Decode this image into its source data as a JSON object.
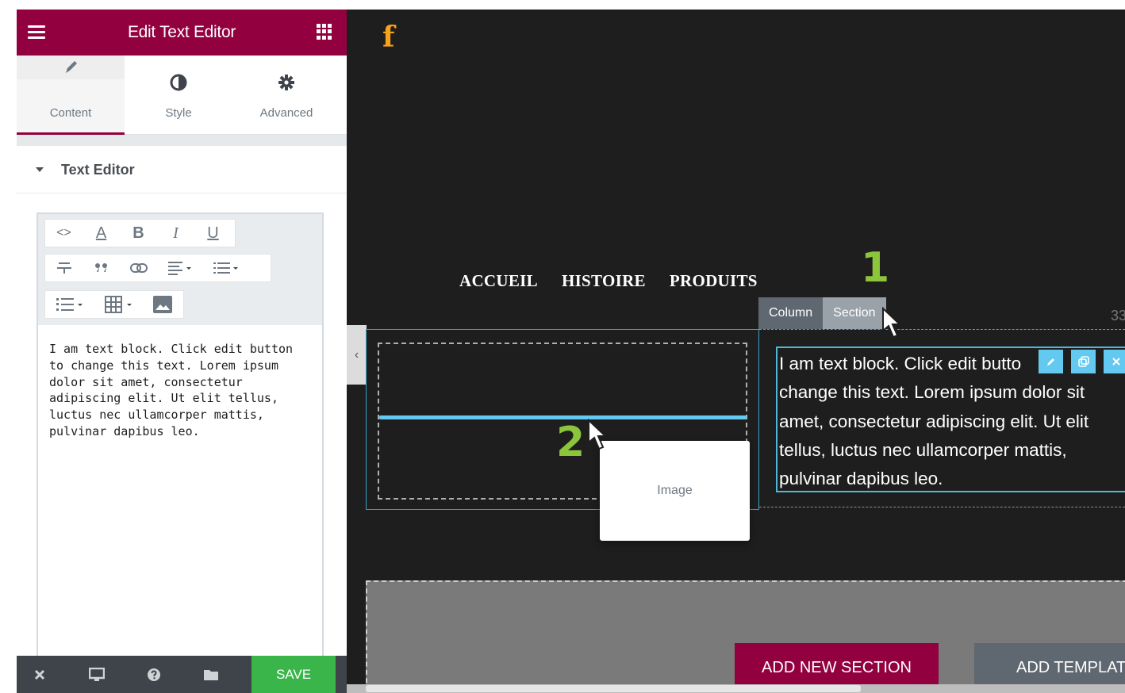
{
  "panel": {
    "title": "Edit Text Editor",
    "tabs": [
      {
        "label": "Content",
        "icon": "pencil-icon",
        "active": true
      },
      {
        "label": "Style",
        "icon": "half-circle-icon",
        "active": false
      },
      {
        "label": "Advanced",
        "icon": "gear-icon",
        "active": false
      }
    ],
    "section_title": "Text Editor",
    "editor_text": "I am text block. Click edit button to change this text. Lorem ipsum dolor sit amet, consectetur adipiscing elit. Ut elit tellus, luctus nec ullamcorper mattis, pulvinar dapibus leo.",
    "toolbar": {
      "row1": [
        "code-icon",
        "text-color-icon",
        "bold-icon",
        "italic-icon",
        "underline-icon"
      ],
      "bold_label": "B",
      "italic_label": "I",
      "underline_label": "U",
      "color_label": "A",
      "code_label": "<>"
    },
    "footer": {
      "save_label": "SAVE"
    },
    "colors": {
      "brand": "#93003f",
      "save": "#39b54a"
    }
  },
  "canvas": {
    "logo": "f",
    "nav": [
      "ACCUEIL",
      "HISTOIRE",
      "PRODUITS"
    ],
    "annotations": {
      "one": "1",
      "two": "2"
    },
    "handle_tags": {
      "column": "Column",
      "section": "Section"
    },
    "section_size": "33",
    "text_block": "I am text block. Click edit butto change this text. Lorem ipsum dolor sit amet, consectetur adipiscing elit. Ut elit tellus, luctus nec ullamcorper mattis, pulvinar dapibus leo.",
    "text_block_lines": [
      "I am text block. Click edit butto",
      "change this text. Lorem ipsum dolor sit",
      "amet, consectetur adipiscing elit. Ut elit",
      "tellus, luctus nec ullamcorper mattis,",
      "pulvinar dapibus leo."
    ],
    "drag_widget": "Image",
    "add_section_label": "ADD NEW SECTION",
    "add_template_label": "ADD TEMPLAT",
    "colors": {
      "accent": "#63c9f0",
      "annotation": "#8cc43c"
    }
  }
}
